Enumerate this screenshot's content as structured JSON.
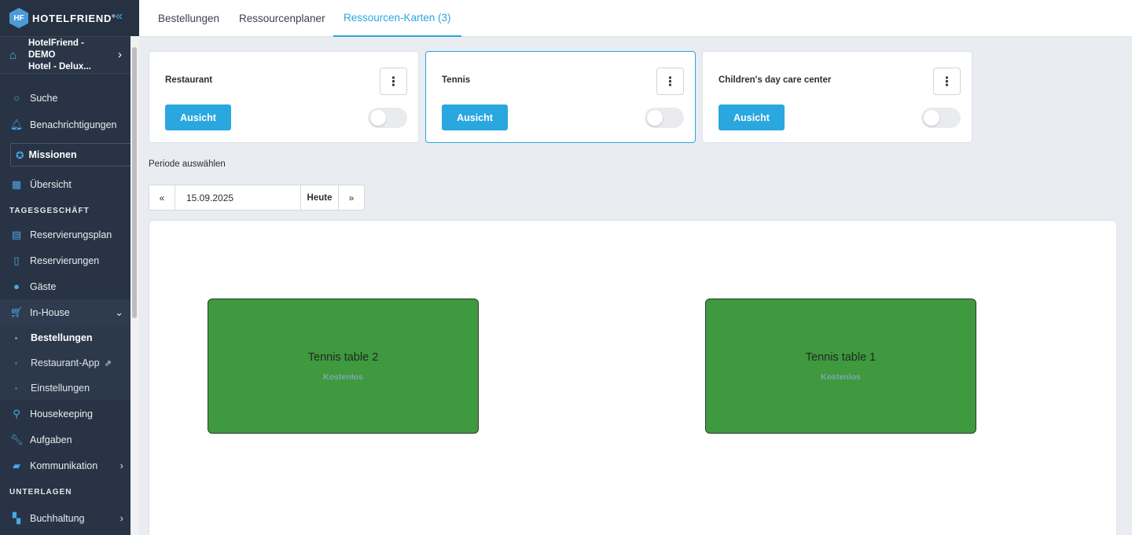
{
  "app": {
    "logo_text": "HOTELFRIEND",
    "logo_mark": "HF",
    "reg": "®"
  },
  "hotel": {
    "line1": "HotelFriend - DEMO",
    "line2": "Hotel - Delux..."
  },
  "sidebar": {
    "search": "Suche",
    "notifications": "Benachrichtigungen",
    "missions": "Missionen",
    "overview": "Übersicht",
    "section_daily": "TAGESGESCHÄFT",
    "reservation_plan": "Reservierungsplan",
    "reservations": "Reservierungen",
    "guests": "Gäste",
    "inhouse": "In-House",
    "inhouse_sub": [
      {
        "label": "Bestellungen"
      },
      {
        "label": "Restaurant-App"
      },
      {
        "label": "Einstellungen"
      }
    ],
    "housekeeping": "Housekeeping",
    "tasks": "Aufgaben",
    "communication": "Kommunikation",
    "section_docs": "UNTERLAGEN",
    "accounting": "Buchhaltung"
  },
  "tabs": [
    {
      "label": "Bestellungen"
    },
    {
      "label": "Ressourcenplaner"
    },
    {
      "label": "Ressourcen-Karten (3)"
    }
  ],
  "resource_cards": [
    {
      "name": "Restaurant",
      "button": "Ausicht"
    },
    {
      "name": "Tennis",
      "button": "Ausicht"
    },
    {
      "name": "Children's day care center",
      "button": "Ausicht"
    }
  ],
  "period": {
    "label": "Periode auswählen",
    "prev": "«",
    "date": "15.09.2025",
    "today": "Heute",
    "next": "»"
  },
  "tables": [
    {
      "name": "Tennis table 2",
      "price": "Kostenlos"
    },
    {
      "name": "Tennis table 1",
      "price": "Kostenlos"
    }
  ],
  "colors": {
    "accent": "#2aa7df",
    "table_fill": "#3f993f",
    "sidebar_bg": "#283445"
  }
}
